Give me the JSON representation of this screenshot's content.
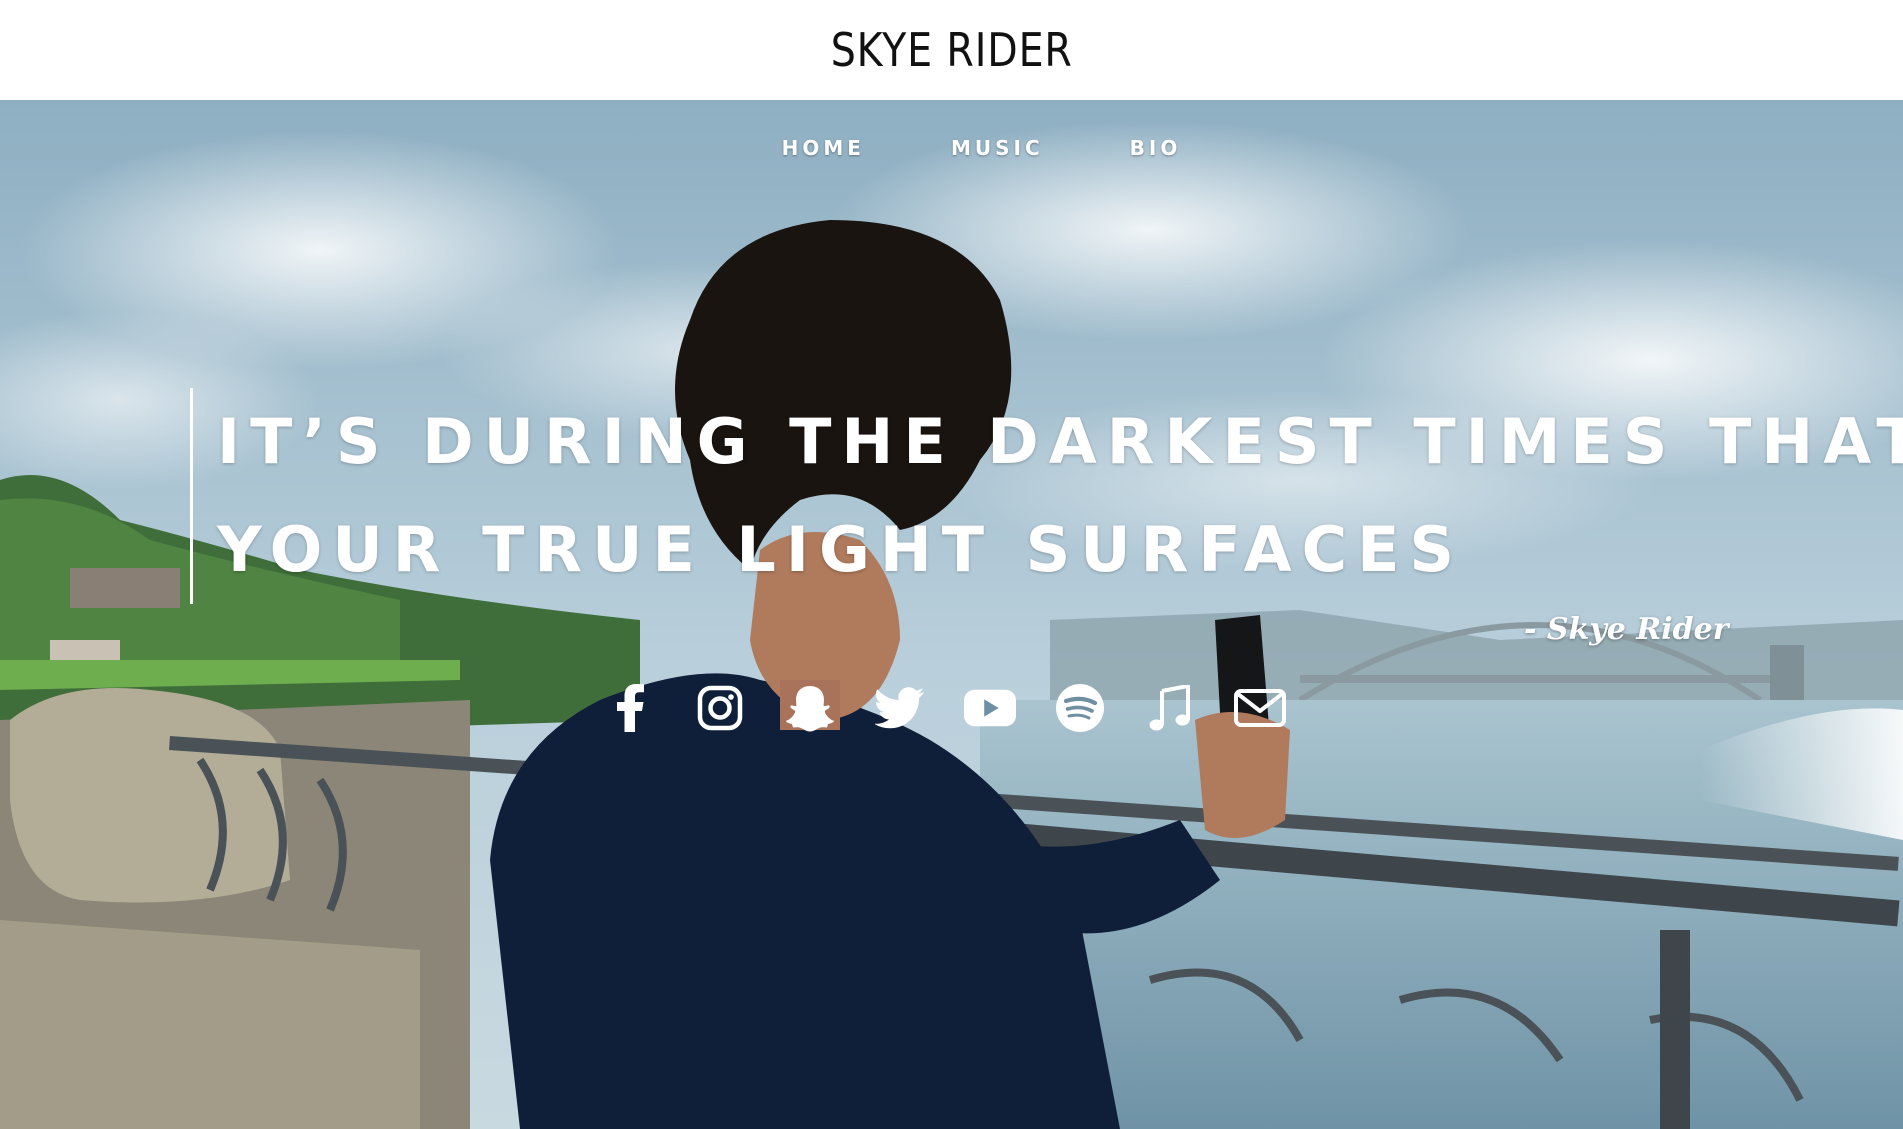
{
  "site": {
    "title": "SKYE RIDER"
  },
  "nav": {
    "items": [
      {
        "label": "HOME"
      },
      {
        "label": "MUSIC"
      },
      {
        "label": "BIO"
      }
    ]
  },
  "hero": {
    "quote_lines": [
      "IT’S DURING THE DARKEST TIMES THAT",
      "YOUR TRUE LIGHT SURFACES"
    ],
    "attribution": "- Skye Rider"
  },
  "social": {
    "icons": [
      "facebook-icon",
      "instagram-icon",
      "snapchat-icon",
      "twitter-icon",
      "youtube-icon",
      "spotify-icon",
      "music-note-icon",
      "email-icon"
    ]
  },
  "colors": {
    "header_bg": "#ffffff",
    "title_text": "#111111",
    "hero_text": "#ffffff",
    "sky": "#9fbfd0",
    "water": "#8fb3c3",
    "sweater": "#0f1f3a",
    "railing": "#3e464c"
  }
}
